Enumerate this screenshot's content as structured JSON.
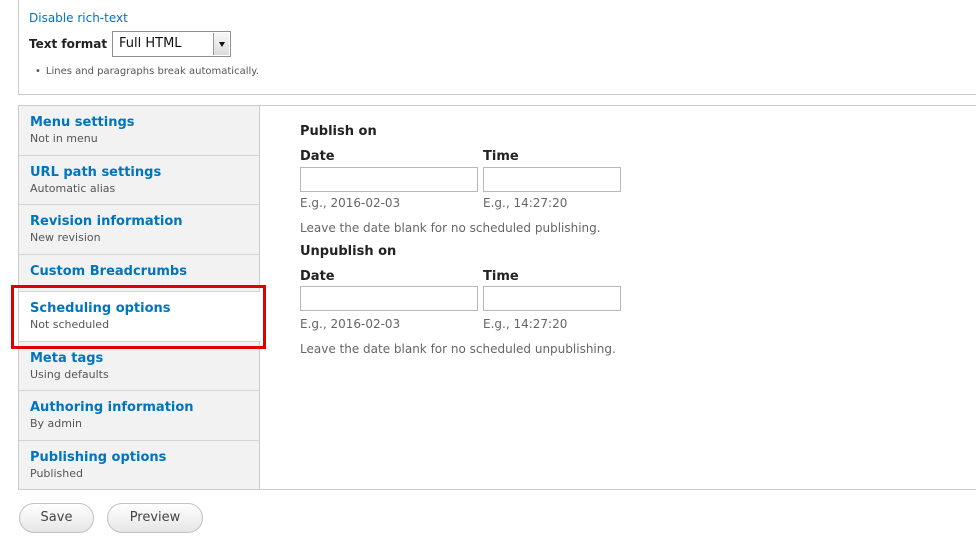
{
  "format": {
    "disable_link": "Disable rich-text",
    "label": "Text format",
    "selected": "Full HTML",
    "tips": [
      "Lines and paragraphs break automatically."
    ]
  },
  "vertical_tabs": [
    {
      "title": "Menu settings",
      "summary": "Not in menu"
    },
    {
      "title": "URL path settings",
      "summary": "Automatic alias"
    },
    {
      "title": "Revision information",
      "summary": "New revision"
    },
    {
      "title": "Custom Breadcrumbs",
      "summary": ""
    },
    {
      "title": "Scheduling options",
      "summary": "Not scheduled"
    },
    {
      "title": "Meta tags",
      "summary": "Using defaults"
    },
    {
      "title": "Authoring information",
      "summary": "By admin"
    },
    {
      "title": "Publishing options",
      "summary": "Published"
    }
  ],
  "scheduling": {
    "publish": {
      "heading": "Publish on",
      "date_label": "Date",
      "time_label": "Time",
      "date_value": "",
      "time_value": "",
      "date_example": "E.g., 2016-02-03",
      "time_example": "E.g., 14:27:20",
      "description": "Leave the date blank for no scheduled publishing."
    },
    "unpublish": {
      "heading": "Unpublish on",
      "date_label": "Date",
      "time_label": "Time",
      "date_value": "",
      "time_value": "",
      "date_example": "E.g., 2016-02-03",
      "time_example": "E.g., 14:27:20",
      "description": "Leave the date blank for no scheduled unpublishing."
    }
  },
  "actions": {
    "save": "Save",
    "preview": "Preview"
  },
  "colors": {
    "link": "#0074bd",
    "highlight": "#e00000",
    "tab_bg": "#f2f2f2"
  }
}
